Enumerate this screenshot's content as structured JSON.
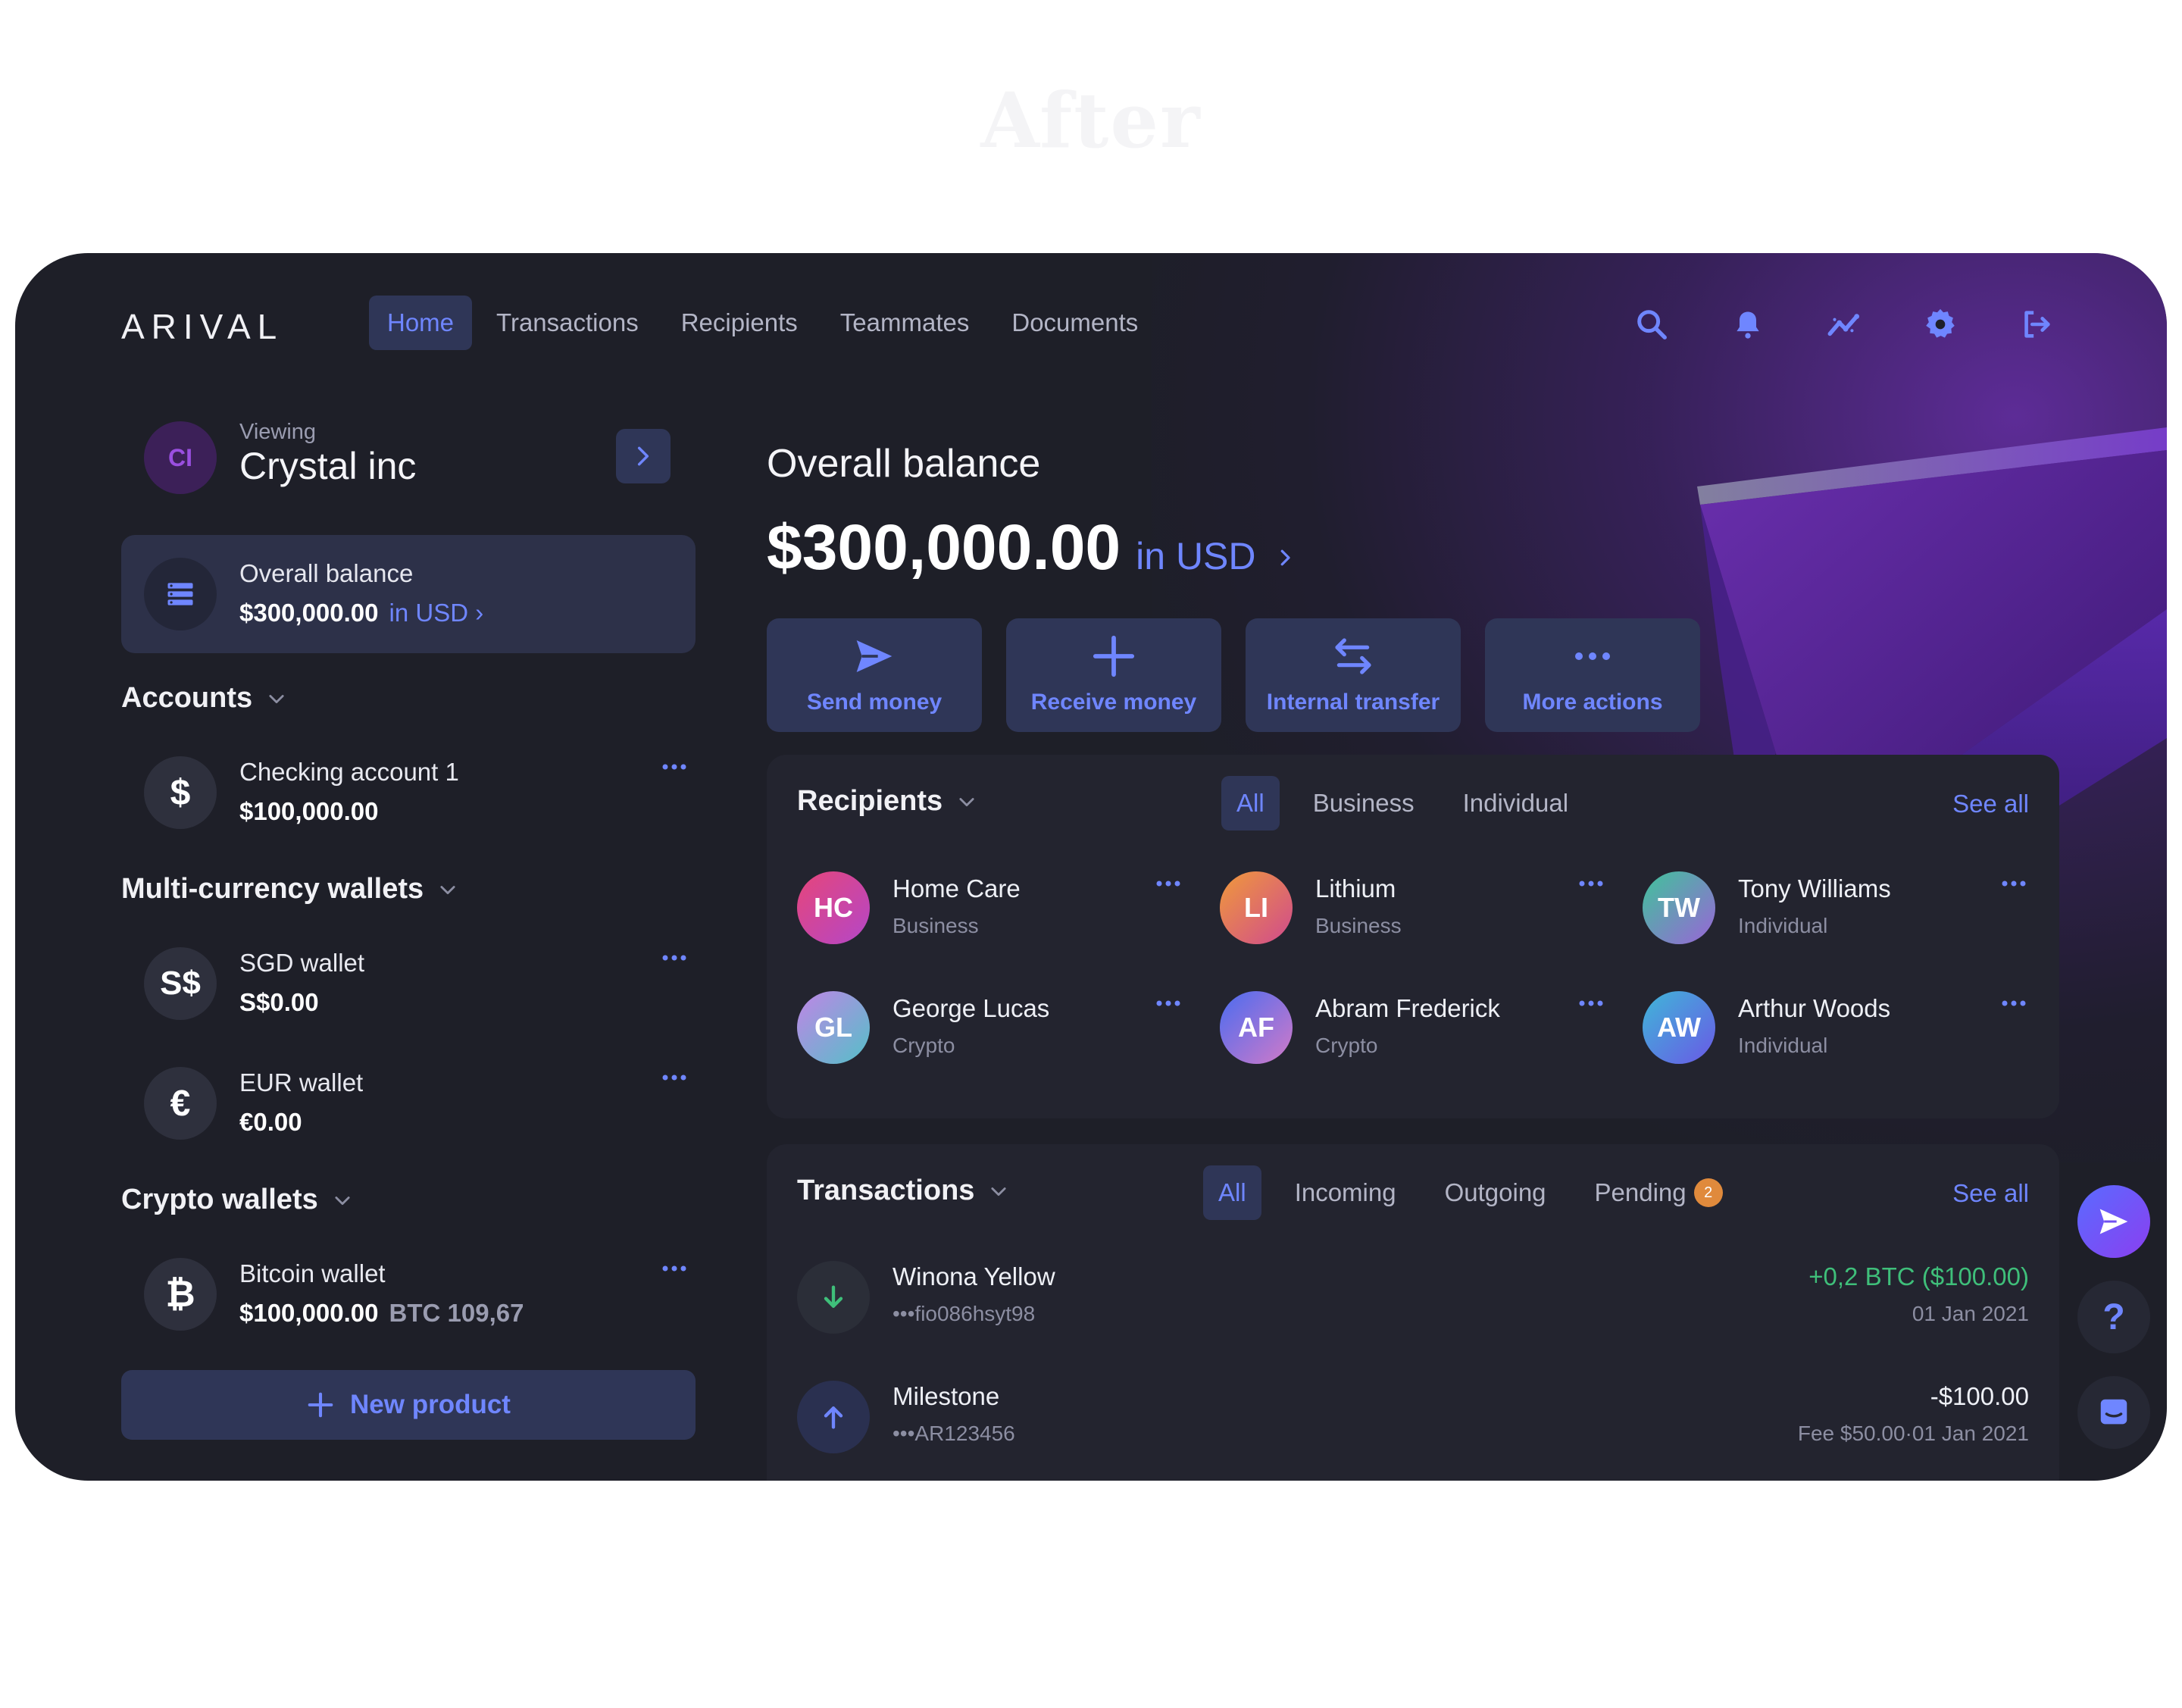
{
  "page_heading": "After",
  "app": {
    "logo": "ARIVAL",
    "nav": [
      "Home",
      "Transactions",
      "Recipients",
      "Teammates",
      "Documents"
    ],
    "nav_icons": [
      "search-icon",
      "bell-icon",
      "analytics-icon",
      "gear-icon",
      "logout-icon"
    ],
    "colors": {
      "background": "#1e1f28",
      "accent": "#6f86ff",
      "card": "#2f3657",
      "panel": "#23242f",
      "positive": "#3fbf7a",
      "purple": "#8a3ff0"
    }
  },
  "sidebar": {
    "company_initials": "CI",
    "viewing_label": "Viewing",
    "company_name": "Crystal inc",
    "balance_card": {
      "label": "Overall balance",
      "amount": "$300,000.00",
      "currency": "in USD ›"
    },
    "accounts_title": "Accounts",
    "accounts": [
      {
        "icon": "$",
        "name": "Checking account 1",
        "amount": "$100,000.00"
      }
    ],
    "wallets_title": "Multi-currency wallets",
    "wallets": [
      {
        "icon": "S$",
        "name": "SGD wallet",
        "amount": "S$0.00"
      },
      {
        "icon": "€",
        "name": "EUR wallet",
        "amount": "€0.00"
      }
    ],
    "crypto_title": "Crypto wallets",
    "crypto": [
      {
        "icon": "₿",
        "name": "Bitcoin wallet",
        "amount": "$100,000.00",
        "sub_amount": "BTC 109,67"
      }
    ],
    "new_product_label": "New product"
  },
  "main": {
    "title": "Overall balance",
    "amount": "$300,000.00",
    "currency": "in USD",
    "actions": [
      "Send money",
      "Receive money",
      "Internal transfer",
      "More actions"
    ]
  },
  "recipients": {
    "title": "Recipients",
    "tabs": [
      "All",
      "Business",
      "Individual"
    ],
    "see_all": "See all",
    "items": [
      {
        "initials": "HC",
        "name": "Home Care",
        "type": "Business"
      },
      {
        "initials": "LI",
        "name": "Lithium",
        "type": "Business"
      },
      {
        "initials": "TW",
        "name": "Tony Williams",
        "type": "Individual"
      },
      {
        "initials": "GL",
        "name": "George Lucas",
        "type": "Crypto"
      },
      {
        "initials": "AF",
        "name": "Abram Frederick",
        "type": "Crypto"
      },
      {
        "initials": "AW",
        "name": "Arthur Woods",
        "type": "Individual"
      }
    ]
  },
  "transactions": {
    "title": "Transactions",
    "tabs": [
      "All",
      "Incoming",
      "Outgoing",
      "Pending"
    ],
    "pending_count": "2",
    "see_all": "See all",
    "items": [
      {
        "name": "Winona Yellow",
        "ref": "•••fio086hsyt98",
        "amount": "+0,2 BTC ($100.00)",
        "date": "01 Jan 2021",
        "direction": "incoming"
      },
      {
        "name": "Milestone",
        "ref": "•••AR123456",
        "amount": "-$100.00",
        "date": "Fee $50.00·01 Jan 2021",
        "direction": "outgoing"
      }
    ]
  },
  "floating": {
    "help_symbol": "?"
  }
}
